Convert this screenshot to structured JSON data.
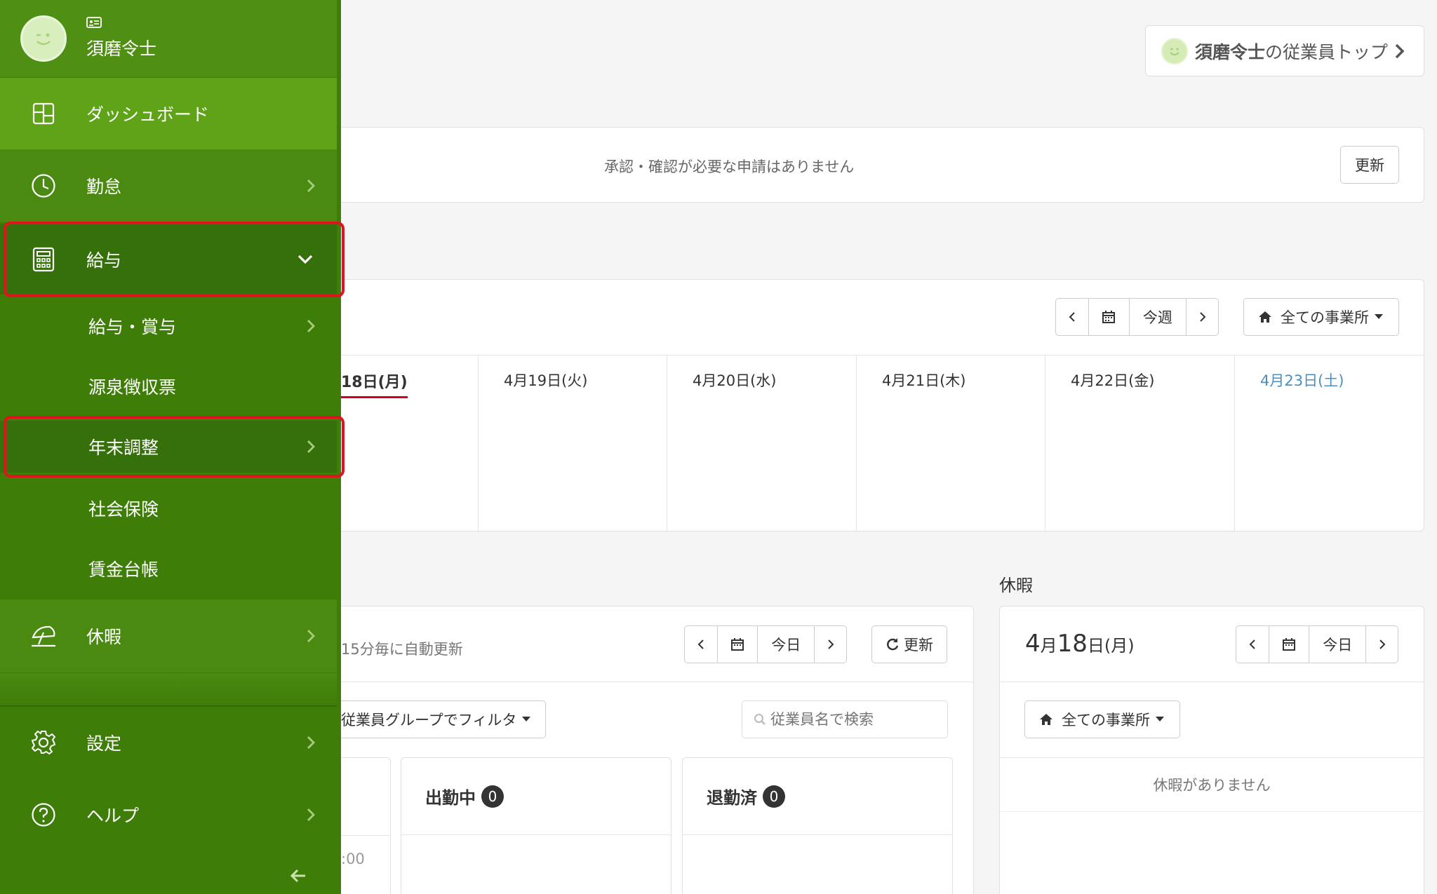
{
  "sidebar": {
    "user_name": "須磨令士",
    "items": [
      {
        "label": "ダッシュボード",
        "icon": "grid-icon"
      },
      {
        "label": "勤怠",
        "icon": "clock-icon"
      },
      {
        "label": "給与",
        "icon": "calculator-icon"
      },
      {
        "label": "休暇",
        "icon": "umbrella-icon"
      },
      {
        "label": "設定",
        "icon": "gear-icon"
      },
      {
        "label": "ヘルプ",
        "icon": "question-circle-icon"
      }
    ],
    "sub_items": [
      "給与・賞与",
      "源泉徴収票",
      "年末調整",
      "社会保険",
      "賃金台帳"
    ]
  },
  "header": {
    "employee_top_name": "須磨令士",
    "employee_top_suffix": "の従業員トップ"
  },
  "approvals": {
    "message": "承認・確認が必要な申請はありません",
    "refresh_label": "更新"
  },
  "calendar": {
    "week_label": "今週",
    "office_filter": "全ての事業所",
    "days": [
      "18日(月)",
      "4月19日(火)",
      "4月20日(水)",
      "4月21日(木)",
      "4月22日(金)",
      "4月23日(土)"
    ]
  },
  "attendance": {
    "auto_refresh": "15分毎に自動更新",
    "today_label": "今日",
    "refresh_label": "更新",
    "group_filter": "従業員グループでフィルタ",
    "search_placeholder": "従業員名で検索",
    "time_fragment": ":00",
    "columns": [
      {
        "label": "出勤中",
        "count": "0"
      },
      {
        "label": "退勤済",
        "count": "0"
      }
    ]
  },
  "vacation": {
    "section_title": "休暇",
    "month": "4",
    "month_unit": "月",
    "day": "18",
    "day_unit": "日(月)",
    "today_label": "今日",
    "office_filter": "全ての事業所",
    "empty_message": "休暇がありません"
  },
  "colors": {
    "sidebar_bg": "#3e7d08",
    "sidebar_active": "#5fa318",
    "highlight": "#e0141e",
    "today_underline": "#d0021b",
    "saturday": "#4a90c2"
  }
}
